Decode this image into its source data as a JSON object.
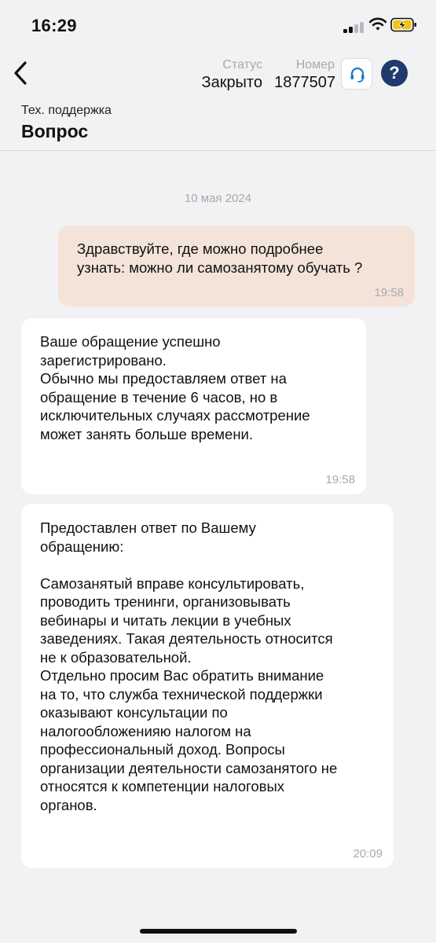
{
  "status_bar": {
    "time": "16:29",
    "icons": [
      "cellular-signal-icon",
      "wifi-icon",
      "battery-charging-icon"
    ],
    "battery_color": "#f4c20d"
  },
  "header": {
    "status_label": "Статус",
    "status_value": "Закрыто",
    "number_label": "Номер",
    "number_value": "1877507",
    "help_label": "?",
    "accent_color": "#1f3a6d"
  },
  "ticket": {
    "category": "Тех. поддержка",
    "title": "Вопрос"
  },
  "chat": {
    "date": "10 мая 2024",
    "messages": [
      {
        "direction": "outgoing",
        "text": "Здравствуйте, где можно подробнее\nузнать: можно ли самозанятому обучать ?",
        "time": "19:58"
      },
      {
        "direction": "incoming",
        "text": "Ваше обращение успешно\nзарегистрировано.\nОбычно мы предоставляем ответ на\nобращение в течение 6 часов, но в\nисключительных случаях рассмотрение\nможет занять больше времени.",
        "time": "19:58"
      },
      {
        "direction": "incoming",
        "text": "Предоставлен ответ по Вашему\nобращению:\n\nСамозанятый вправе консультировать,\nпроводить тренинги, организовывать\nвебинары и читать лекции в учебных\nзаведениях. Такая деятельность относится\nне к образовательной.\nОтдельно просим Вас обратить внимание\nна то, что служба технической поддержки\nоказывают консультации по\nналогообложенияю налогом на\nпрофессиональный доход. Вопросы\nорганизации деятельности самозанятого не\nотносятся к компетенции налоговых\nорганов.",
        "time": "20:09"
      }
    ]
  }
}
